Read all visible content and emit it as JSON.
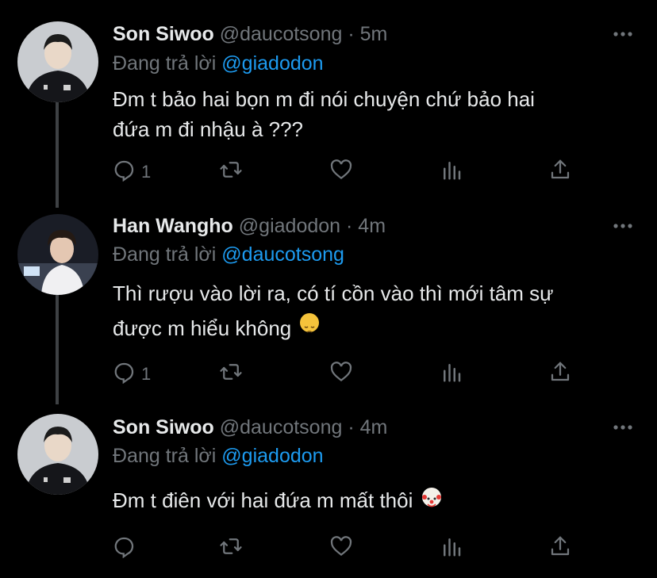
{
  "tweets": [
    {
      "name": "Son Siwoo",
      "handle": "@daucotsong",
      "dot": "·",
      "time": "5m",
      "reply_prefix": "Đang trả lời",
      "reply_to": "@giadodon",
      "text_line1": "Đm t bảo hai bọn m đi nói chuyện chứ bảo hai",
      "text_line2": "đứa m đi nhậu à ???",
      "reply_count": "1"
    },
    {
      "name": "Han Wangho",
      "handle": "@giadodon",
      "dot": "·",
      "time": "4m",
      "reply_prefix": "Đang trả lời",
      "reply_to": "@daucotsong",
      "text_line1": "Thì rượu vào lời ra, có tí cồn vào thì mới tâm sự",
      "text_line2": "được m hiểu không",
      "emoji": "pensive-face",
      "reply_count": "1"
    },
    {
      "name": "Son Siwoo",
      "handle": "@daucotsong",
      "dot": "·",
      "time": "4m",
      "reply_prefix": "Đang trả lời",
      "reply_to": "@giadodon",
      "text_line1": "Đm t điên với hai đứa m mất thôi",
      "emoji": "clown-face",
      "reply_count": ""
    }
  ],
  "colors": {
    "background": "#000000",
    "text": "#e7e9ea",
    "secondary": "#71767b",
    "link": "#1d9bf0",
    "thread_line": "#3e4144"
  },
  "icons": [
    "reply-icon",
    "retweet-icon",
    "like-icon",
    "analytics-icon",
    "share-icon",
    "more-icon"
  ]
}
